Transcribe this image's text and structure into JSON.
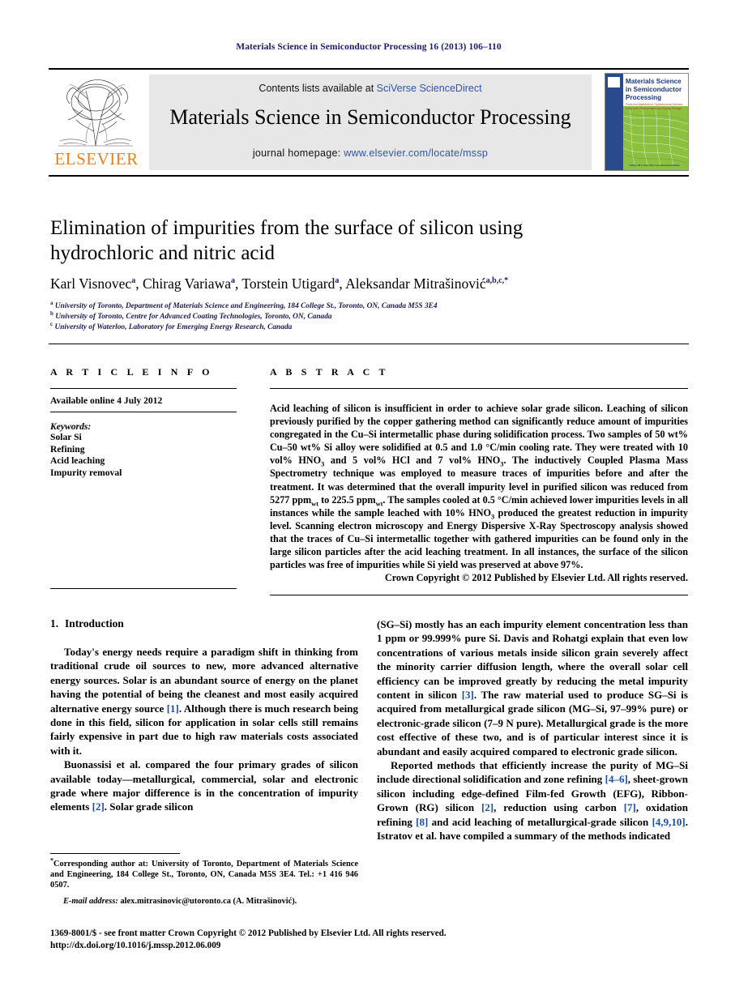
{
  "running_head": "Materials Science in Semiconductor Processing 16 (2013) 106–110",
  "masthead": {
    "publisher_name": "ELSEVIER",
    "contents_prefix": "Contents lists available at ",
    "contents_brand": "SciVerse ScienceDirect",
    "journal_title": "Materials Science in Semiconductor Processing",
    "homepage_label": "journal homepage: ",
    "homepage_url": "www.elsevier.com/locate/mssp",
    "cover": {
      "line1": "Materials Science",
      "line2": "in Semiconductor",
      "line3": "Processing",
      "sub": "Front-end Materials for Optoelectronic Devices\nSolar cells, Photovoltaics and Energy Storage",
      "footer": "Editor: M.Y. Han, M.S. Lee, Executive Editor"
    }
  },
  "article": {
    "title": "Elimination of impurities from the surface of silicon using hydrochloric and nitric acid",
    "authors": [
      {
        "name": "Karl Visnovec",
        "sup": "a"
      },
      {
        "name": "Chirag Variawa",
        "sup": "a"
      },
      {
        "name": "Torstein Utigard",
        "sup": "a"
      },
      {
        "name": "Aleksandar Mitrašinović",
        "sup": "a,b,c,*"
      }
    ],
    "affiliations": [
      {
        "marker": "a",
        "text": "University of Toronto, Department of Materials Science and Engineering, 184 College St., Toronto, ON, Canada M5S 3E4"
      },
      {
        "marker": "b",
        "text": "University of Toronto, Centre for Advanced Coating Technologies, Toronto, ON, Canada"
      },
      {
        "marker": "c",
        "text": "University of Waterloo, Laboratory for Emerging Energy Research, Canada"
      }
    ]
  },
  "article_info": {
    "heading": "A R T I C L E   I N F O",
    "history": "Available online 4 July 2012",
    "keywords_label": "Keywords:",
    "keywords": [
      "Solar Si",
      "Refining",
      "Acid leaching",
      "Impurity removal"
    ]
  },
  "abstract": {
    "heading": "A B S T R A C T",
    "body_part1": "Acid leaching of silicon is insufficient in order to achieve solar grade silicon. Leaching of silicon previously purified by the copper gathering method can significantly reduce amount of impurities congregated in the Cu–Si intermetallic phase during solidification process. Two samples of 50 wt% Cu–50 wt% Si alloy were solidified at 0.5 and 1.0 °C/min cooling rate. They were treated with 10 vol% HNO",
    "sub1": "3",
    "body_part2": " and 5 vol% HCl and 7 vol% HNO",
    "sub2": "3",
    "body_part3": ". The inductively Coupled Plasma Mass Spectrometry technique was employed to measure traces of impurities before and after the treatment. It was determined that the overall impurity level in purified silicon was reduced from 5277 ppm",
    "sub3": "wt",
    "body_part4": " to 225.5 ppm",
    "sub4": "wt",
    "body_part5": ". The samples cooled at 0.5 °C/min achieved lower impurities levels in all instances while the sample leached with 10% HNO",
    "sub5": "3",
    "body_part6": " produced the greatest reduction in impurity level. Scanning electron microscopy and Energy Dispersive X-Ray Spectroscopy analysis showed that the traces of Cu–Si intermetallic together with gathered impurities can be found only in the large silicon particles after the acid leaching treatment. In all instances, the surface of the silicon particles was free of impurities while Si yield was preserved at above 97%.",
    "copyright": "Crown Copyright © 2012 Published by Elsevier Ltd. All rights reserved."
  },
  "introduction": {
    "number": "1.",
    "heading": "Introduction",
    "left_paragraphs": [
      "Today's energy needs require a paradigm shift in thinking from traditional crude oil sources to new, more advanced alternative energy sources. Solar is an abundant source of energy on the planet having the potential of being the cleanest and most easily acquired alternative energy source [1]. Although there is much research being done in this field, silicon for application in solar cells still remains fairly expensive in part due to high raw materials costs associated with it.",
      "Buonassisi et al. compared the four primary grades of silicon available today—metallurgical, commercial, solar and electronic grade where major difference is in the concentration of impurity elements [2]. Solar grade silicon"
    ],
    "right_paragraphs": [
      "(SG–Si) mostly has an each impurity element concentration less than 1 ppm or 99.999% pure Si. Davis and Rohatgi explain that even low concentrations of various metals inside silicon grain severely affect the minority carrier diffusion length, where the overall solar cell efficiency can be improved greatly by reducing the metal impurity content in silicon [3]. The raw material used to produce SG–Si is acquired from metallurgical grade silicon (MG–Si, 97–99% pure) or electronic-grade silicon (7–9 N pure). Metallurgical grade is the more cost effective of these two, and is of particular interest since it is abundant and easily acquired compared to electronic grade silicon.",
      "Reported methods that efficiently increase the purity of MG–Si include directional solidification and zone refining [4–6], sheet-grown silicon including edge-defined Film-fed Growth (EFG), Ribbon-Grown (RG) silicon [2], reduction using carbon [7], oxidation refining [8] and acid leaching of metallurgical-grade silicon [4,9,10]. Istratov et al. have compiled a summary of the methods indicated"
    ],
    "references_inline": [
      "[1]",
      "[2]",
      "[3]",
      "[4–6]",
      "[2]",
      "[7]",
      "[8]",
      "[4,9,10]"
    ]
  },
  "footnote": {
    "corresponding": "Corresponding author at: University of Toronto, Department of Materials Science and Engineering, 184 College St., Toronto, ON, Canada M5S 3E4. Tel.: +1 416 946 0507.",
    "email_label": "E-mail address:",
    "email": "alex.mitrasinovic@utoronto.ca (A. Mitrašinović)."
  },
  "bottom_matter": {
    "issn_line": "1369-8001/$ - see front matter Crown Copyright © 2012 Published by Elsevier Ltd. All rights reserved.",
    "doi": "http://dx.doi.org/10.1016/j.mssp.2012.06.009"
  },
  "colors": {
    "running_head": "#1a1a6e",
    "brand_blue": "#2f55a4",
    "reference_blue": "#1a4fa0",
    "elsevier_orange": "#ef7f1a",
    "band_gray": "#e7e7e7"
  }
}
